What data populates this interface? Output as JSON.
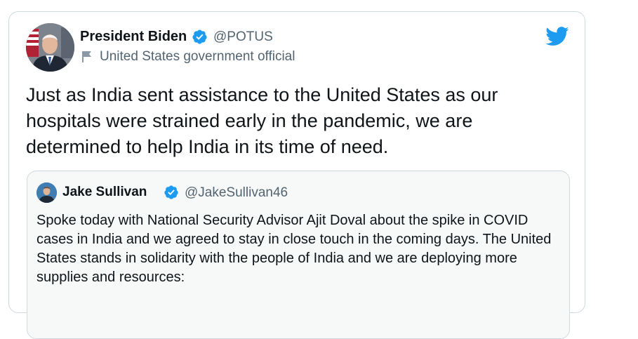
{
  "tweet": {
    "author_name": "President Biden",
    "author_handle": "@POTUS",
    "author_label": "United States government official",
    "text": "Just as India sent assistance to the United States as our hospitals were strained early in the pandemic, we are determined to help India in its time of need."
  },
  "quoted_tweet": {
    "author_name": "Jake Sullivan",
    "author_handle": "@JakeSullivan46",
    "text": "Spoke today with National Security Advisor Ajit Doval about the spike in COVID cases in India and we agreed to stay in close touch in the coming days. The United States stands in solidarity with the people of India and we are deploying more supplies and resources:"
  },
  "icons": {
    "verified": "verified-badge-icon",
    "government": "flag-icon",
    "platform": "twitter-bird-icon"
  },
  "colors": {
    "twitter_blue": "#1d9bf0",
    "text_primary": "#0f1419",
    "text_secondary": "#536471",
    "border": "#cfd9de",
    "quote_background": "#f7f9f9"
  }
}
